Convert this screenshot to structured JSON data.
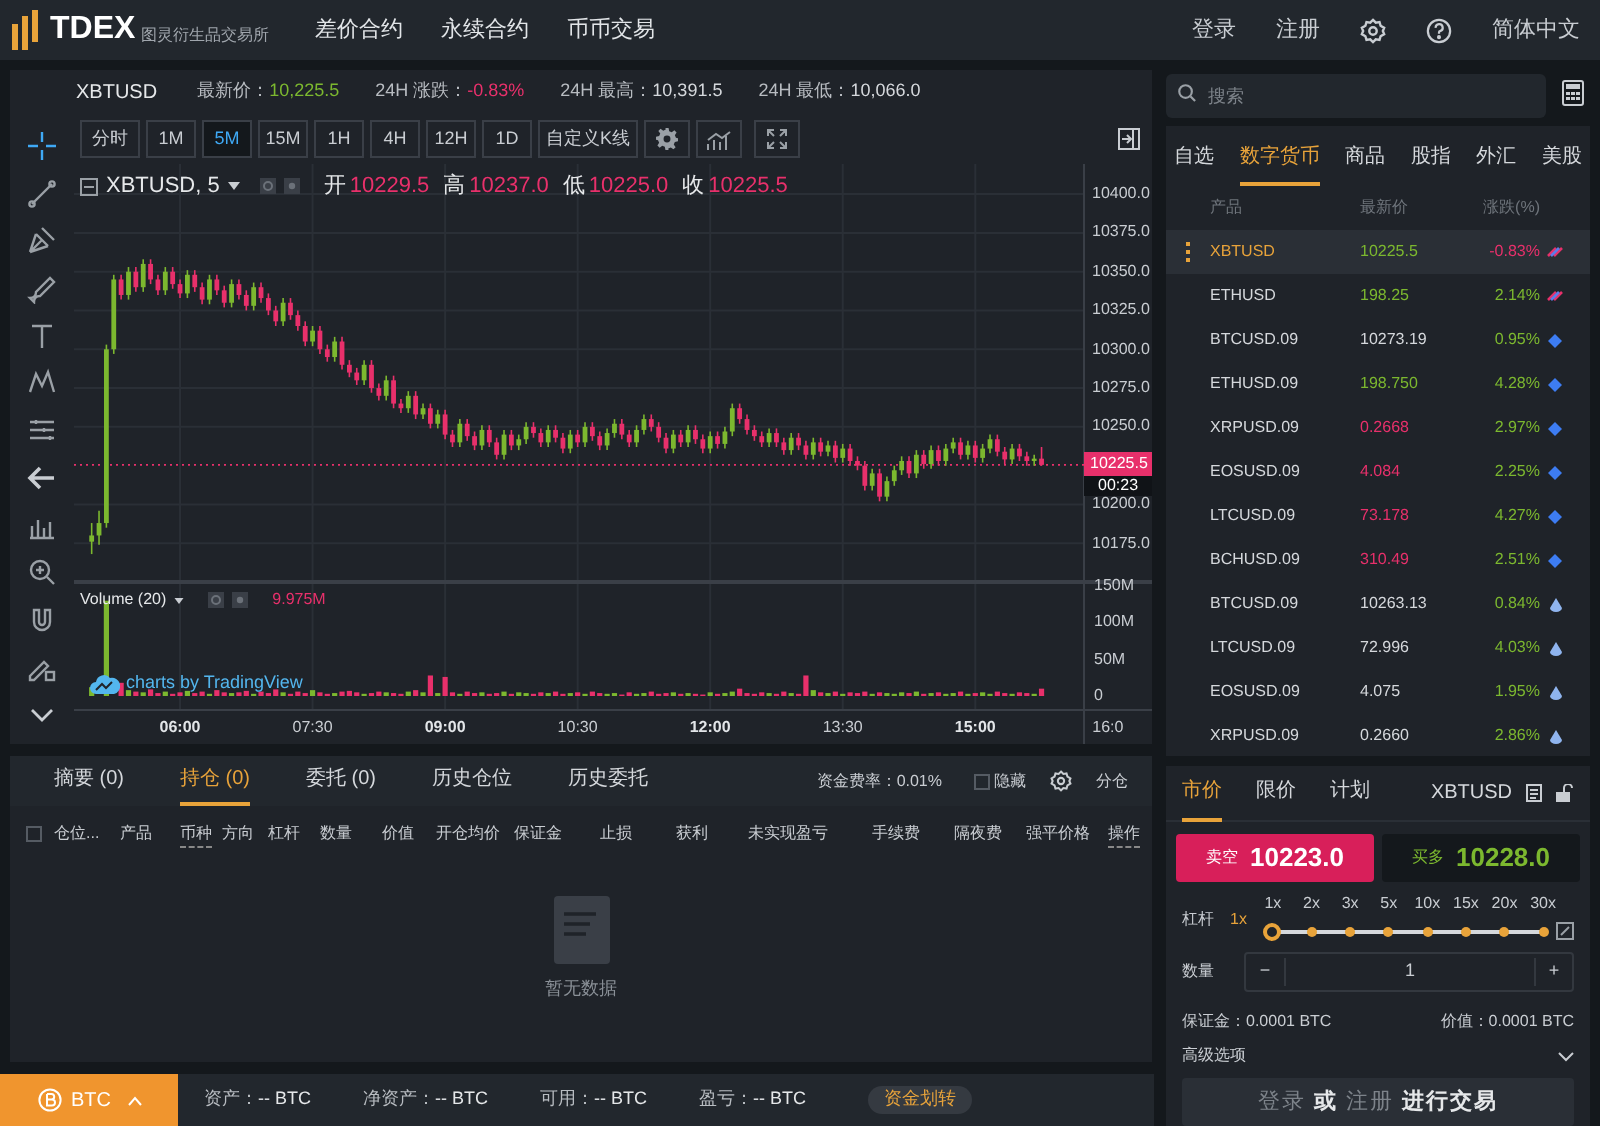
{
  "topbar": {
    "logo": "TDEX",
    "logo_subtitle": "图灵衍生品交易所",
    "nav": [
      "差价合约",
      "永续合约",
      "币币交易"
    ],
    "login": "登录",
    "register": "注册",
    "language": "简体中文"
  },
  "ticker": {
    "symbol": "XBTUSD",
    "stats": [
      {
        "label": "最新价：",
        "value": "10,225.5",
        "color": "#7cb82f"
      },
      {
        "label": "24H 涨跌：",
        "value": "-0.83%",
        "color": "#e8306b"
      },
      {
        "label": "24H 最高：",
        "value": "10,391.5",
        "color": "#d5d8dc"
      },
      {
        "label": "24H 最低：",
        "value": "10,066.0",
        "color": "#d5d8dc"
      }
    ]
  },
  "intervals": [
    {
      "label": "分时",
      "selected": false
    },
    {
      "label": "1M",
      "selected": false
    },
    {
      "label": "5M",
      "selected": true
    },
    {
      "label": "15M",
      "selected": false
    },
    {
      "label": "1H",
      "selected": false
    },
    {
      "label": "4H",
      "selected": false
    },
    {
      "label": "12H",
      "selected": false
    },
    {
      "label": "1D",
      "selected": false
    }
  ],
  "custom_k": "自定义K线",
  "chart": {
    "legend_symbol": "XBTUSD, 5",
    "ohlc_legend": [
      {
        "label": "开",
        "value": "10229.5"
      },
      {
        "label": "高",
        "value": "10237.0"
      },
      {
        "label": "低",
        "value": "10225.0"
      },
      {
        "label": "收",
        "value": "10225.5"
      }
    ],
    "last_price": "10225.5",
    "countdown": "00:23",
    "credit": "charts by TradingView",
    "chart_data": {
      "type": "candlestick",
      "xlim": [
        288,
        1020
      ],
      "ylim": [
        10150,
        10480
      ],
      "yticks": [
        {
          "value": 10400,
          "label": "10400.0"
        },
        {
          "value": 10375,
          "label": "10375.0"
        },
        {
          "value": 10350,
          "label": "10350.0"
        },
        {
          "value": 10325,
          "label": "10325.0"
        },
        {
          "value": 10300,
          "label": "10300.0"
        },
        {
          "value": 10275,
          "label": "10275.0"
        },
        {
          "value": 10250,
          "label": "10250.0"
        },
        {
          "value": 10200,
          "label": "10200.0"
        },
        {
          "value": 10175,
          "label": "10175.0"
        }
      ],
      "x": [
        300,
        305,
        310,
        315,
        320,
        325,
        330,
        335,
        340,
        345,
        350,
        355,
        360,
        365,
        370,
        375,
        380,
        385,
        390,
        395,
        400,
        405,
        410,
        415,
        420,
        425,
        430,
        435,
        440,
        445,
        450,
        455,
        460,
        465,
        470,
        475,
        480,
        485,
        490,
        495,
        500,
        505,
        510,
        515,
        520,
        525,
        530,
        535,
        540,
        545,
        550,
        555,
        560,
        565,
        570,
        575,
        580,
        585,
        590,
        595,
        600,
        605,
        610,
        615,
        620,
        625,
        630,
        635,
        640,
        645,
        650,
        655,
        660,
        665,
        670,
        675,
        680,
        685,
        690,
        695,
        700,
        705,
        710,
        715,
        720,
        725,
        730,
        735,
        740,
        745,
        750,
        755,
        760,
        765,
        770,
        775,
        780,
        785,
        790,
        795,
        800,
        805,
        810,
        815,
        820,
        825,
        830,
        835,
        840,
        845,
        850,
        855,
        860,
        865,
        870,
        875,
        880,
        885,
        890,
        895,
        900,
        905,
        910,
        915,
        920,
        925,
        930,
        935,
        940,
        945
      ],
      "ohlc": [
        [
          10176,
          10188,
          10168,
          10180
        ],
        [
          10180,
          10196,
          10174,
          10188
        ],
        [
          10188,
          10303,
          10185,
          10300
        ],
        [
          10300,
          10348,
          10297,
          10345
        ],
        [
          10345,
          10348,
          10332,
          10335
        ],
        [
          10335,
          10353,
          10332,
          10350
        ],
        [
          10350,
          10353,
          10337,
          10340
        ],
        [
          10340,
          10358,
          10337,
          10355
        ],
        [
          10355,
          10358,
          10342,
          10345
        ],
        [
          10345,
          10348,
          10335,
          10338
        ],
        [
          10338,
          10353,
          10335,
          10350
        ],
        [
          10350,
          10353,
          10339,
          10342
        ],
        [
          10342,
          10345,
          10333,
          10336
        ],
        [
          10336,
          10351,
          10333,
          10348
        ],
        [
          10348,
          10351,
          10337,
          10340
        ],
        [
          10340,
          10343,
          10329,
          10332
        ],
        [
          10332,
          10348,
          10329,
          10345
        ],
        [
          10345,
          10348,
          10335,
          10338
        ],
        [
          10338,
          10341,
          10327,
          10330
        ],
        [
          10330,
          10345,
          10327,
          10342
        ],
        [
          10342,
          10345,
          10332,
          10335
        ],
        [
          10335,
          10338,
          10325,
          10328
        ],
        [
          10328,
          10343,
          10325,
          10340
        ],
        [
          10340,
          10343,
          10330,
          10333
        ],
        [
          10333,
          10336,
          10322,
          10325
        ],
        [
          10325,
          10328,
          10315,
          10318
        ],
        [
          10318,
          10333,
          10315,
          10330
        ],
        [
          10330,
          10333,
          10319,
          10322
        ],
        [
          10322,
          10325,
          10312,
          10315
        ],
        [
          10315,
          10318,
          10302,
          10305
        ],
        [
          10305,
          10315,
          10302,
          10312
        ],
        [
          10312,
          10315,
          10297,
          10300
        ],
        [
          10300,
          10303,
          10292,
          10295
        ],
        [
          10295,
          10308,
          10292,
          10305
        ],
        [
          10305,
          10308,
          10287,
          10290
        ],
        [
          10290,
          10293,
          10282,
          10285
        ],
        [
          10285,
          10288,
          10277,
          10280
        ],
        [
          10280,
          10293,
          10277,
          10290
        ],
        [
          10290,
          10293,
          10272,
          10275
        ],
        [
          10275,
          10278,
          10267,
          10270
        ],
        [
          10270,
          10283,
          10267,
          10280
        ],
        [
          10280,
          10283,
          10262,
          10265
        ],
        [
          10265,
          10268,
          10259,
          10262
        ],
        [
          10262,
          10273,
          10259,
          10270
        ],
        [
          10270,
          10273,
          10255,
          10258
        ],
        [
          10258,
          10265,
          10255,
          10262
        ],
        [
          10262,
          10265,
          10249,
          10252
        ],
        [
          10252,
          10261,
          10249,
          10258
        ],
        [
          10258,
          10261,
          10242,
          10245
        ],
        [
          10245,
          10248,
          10237,
          10240
        ],
        [
          10240,
          10255,
          10237,
          10252
        ],
        [
          10252,
          10255,
          10241,
          10244
        ],
        [
          10244,
          10247,
          10235,
          10238
        ],
        [
          10238,
          10251,
          10235,
          10248
        ],
        [
          10248,
          10251,
          10237,
          10240
        ],
        [
          10240,
          10243,
          10229,
          10232
        ],
        [
          10232,
          10248,
          10229,
          10245
        ],
        [
          10245,
          10248,
          10235,
          10238
        ],
        [
          10238,
          10245,
          10235,
          10242
        ],
        [
          10242,
          10253,
          10239,
          10250
        ],
        [
          10250,
          10253,
          10243,
          10246
        ],
        [
          10246,
          10249,
          10237,
          10240
        ],
        [
          10240,
          10251,
          10237,
          10248
        ],
        [
          10248,
          10251,
          10240,
          10243
        ],
        [
          10243,
          10246,
          10233,
          10236
        ],
        [
          10236,
          10248,
          10233,
          10245
        ],
        [
          10245,
          10248,
          10237,
          10240
        ],
        [
          10240,
          10253,
          10237,
          10250
        ],
        [
          10250,
          10253,
          10241,
          10244
        ],
        [
          10244,
          10247,
          10235,
          10238
        ],
        [
          10238,
          10249,
          10235,
          10246
        ],
        [
          10246,
          10255,
          10243,
          10252
        ],
        [
          10252,
          10255,
          10242,
          10245
        ],
        [
          10245,
          10248,
          10237,
          10240
        ],
        [
          10240,
          10251,
          10237,
          10248
        ],
        [
          10248,
          10258,
          10245,
          10255
        ],
        [
          10255,
          10258,
          10247,
          10250
        ],
        [
          10250,
          10253,
          10240,
          10243
        ],
        [
          10243,
          10246,
          10233,
          10236
        ],
        [
          10236,
          10248,
          10233,
          10245
        ],
        [
          10245,
          10248,
          10237,
          10240
        ],
        [
          10240,
          10251,
          10237,
          10248
        ],
        [
          10248,
          10251,
          10239,
          10242
        ],
        [
          10242,
          10245,
          10233,
          10236
        ],
        [
          10236,
          10247,
          10233,
          10244
        ],
        [
          10244,
          10247,
          10236,
          10239
        ],
        [
          10239,
          10250,
          10236,
          10247
        ],
        [
          10247,
          10265,
          10244,
          10262
        ],
        [
          10262,
          10265,
          10252,
          10255
        ],
        [
          10255,
          10258,
          10245,
          10248
        ],
        [
          10248,
          10251,
          10241,
          10244
        ],
        [
          10244,
          10247,
          10237,
          10240
        ],
        [
          10240,
          10249,
          10237,
          10246
        ],
        [
          10246,
          10249,
          10237,
          10240
        ],
        [
          10240,
          10243,
          10232,
          10235
        ],
        [
          10235,
          10246,
          10232,
          10243
        ],
        [
          10243,
          10246,
          10235,
          10238
        ],
        [
          10238,
          10241,
          10229,
          10232
        ],
        [
          10232,
          10243,
          10229,
          10240
        ],
        [
          10240,
          10243,
          10231,
          10234
        ],
        [
          10234,
          10241,
          10231,
          10238
        ],
        [
          10238,
          10241,
          10227,
          10230
        ],
        [
          10230,
          10239,
          10227,
          10236
        ],
        [
          10236,
          10239,
          10225,
          10228
        ],
        [
          10228,
          10231,
          10222,
          10225
        ],
        [
          10225,
          10228,
          10209,
          10212
        ],
        [
          10212,
          10223,
          10209,
          10220
        ],
        [
          10220,
          10223,
          10202,
          10205
        ],
        [
          10205,
          10218,
          10202,
          10215
        ],
        [
          10215,
          10225,
          10212,
          10222
        ],
        [
          10222,
          10231,
          10219,
          10228
        ],
        [
          10228,
          10231,
          10217,
          10220
        ],
        [
          10220,
          10235,
          10217,
          10232
        ],
        [
          10232,
          10235,
          10223,
          10226
        ],
        [
          10226,
          10238,
          10223,
          10235
        ],
        [
          10235,
          10238,
          10225,
          10228
        ],
        [
          10228,
          10239,
          10225,
          10236
        ],
        [
          10236,
          10243,
          10233,
          10240
        ],
        [
          10240,
          10243,
          10229,
          10232
        ],
        [
          10232,
          10241,
          10229,
          10238
        ],
        [
          10238,
          10241,
          10227,
          10230
        ],
        [
          10230,
          10239,
          10227,
          10236
        ],
        [
          10236,
          10245,
          10233,
          10242
        ],
        [
          10242,
          10245,
          10231,
          10234
        ],
        [
          10234,
          10237,
          10226,
          10229
        ],
        [
          10229,
          10239,
          10226,
          10236
        ],
        [
          10236,
          10239,
          10228,
          10231
        ],
        [
          10231,
          10234,
          10225,
          10228
        ],
        [
          10228,
          10232,
          10225,
          10229.5
        ],
        [
          10229.5,
          10237,
          10225,
          10225.5
        ]
      ]
    }
  },
  "volume": {
    "legend": "Volume (20)",
    "value": "9.975M",
    "time_tick_bold": [
      true,
      false,
      true,
      false,
      true,
      false,
      true,
      false
    ],
    "chart_data": {
      "type": "bar",
      "xlim": [
        288,
        1020
      ],
      "ylim": [
        0,
        155.5
      ],
      "xticks": [
        {
          "value": 360,
          "label": "06:00"
        },
        {
          "value": 450,
          "label": "07:30"
        },
        {
          "value": 540,
          "label": "09:00"
        },
        {
          "value": 630,
          "label": "10:30"
        },
        {
          "value": 720,
          "label": "12:00"
        },
        {
          "value": 810,
          "label": "13:30"
        },
        {
          "value": 900,
          "label": "15:00"
        },
        {
          "value": 990,
          "label": "16:0"
        }
      ],
      "yticks": [
        {
          "value": 150,
          "label": "150M"
        },
        {
          "value": 100,
          "label": "100M"
        },
        {
          "value": 50,
          "label": "50M"
        },
        {
          "value": 0,
          "label": "0"
        }
      ],
      "x": [
        300,
        305,
        310,
        315,
        320,
        325,
        330,
        335,
        340,
        345,
        350,
        355,
        360,
        365,
        370,
        375,
        380,
        385,
        390,
        395,
        400,
        405,
        410,
        415,
        420,
        425,
        430,
        435,
        440,
        445,
        450,
        455,
        460,
        465,
        470,
        475,
        480,
        485,
        490,
        495,
        500,
        505,
        510,
        515,
        520,
        525,
        530,
        535,
        540,
        545,
        550,
        555,
        560,
        565,
        570,
        575,
        580,
        585,
        590,
        595,
        600,
        605,
        610,
        615,
        620,
        625,
        630,
        635,
        640,
        645,
        650,
        655,
        660,
        665,
        670,
        675,
        680,
        685,
        690,
        695,
        700,
        705,
        710,
        715,
        720,
        725,
        730,
        735,
        740,
        745,
        750,
        755,
        760,
        765,
        770,
        775,
        780,
        785,
        790,
        795,
        800,
        805,
        810,
        815,
        820,
        825,
        830,
        835,
        840,
        845,
        850,
        855,
        860,
        865,
        870,
        875,
        880,
        885,
        890,
        895,
        900,
        905,
        910,
        915,
        920,
        925,
        930,
        935,
        940,
        945
      ],
      "values": [
        12,
        null,
        130,
        null,
        18,
        8,
        6,
        5,
        9,
        4,
        6,
        3,
        5,
        7,
        4,
        6,
        3,
        8,
        5,
        4,
        5,
        7,
        3,
        6,
        4,
        9,
        5,
        3,
        6,
        4,
        8,
        5,
        3,
        4,
        6,
        7,
        5,
        3,
        4,
        6,
        5,
        4,
        3,
        6,
        8,
        5,
        28,
        4,
        26,
        5,
        3,
        6,
        4,
        5,
        3,
        4,
        6,
        3,
        5,
        4,
        3,
        5,
        4,
        6,
        3,
        4,
        5,
        3,
        6,
        4,
        3,
        4,
        2,
        5,
        3,
        4,
        6,
        3,
        4,
        5,
        3,
        4,
        3,
        2,
        5,
        3,
        4,
        6,
        10,
        4,
        3,
        5,
        4,
        3,
        6,
        4,
        3,
        28,
        8,
        5,
        4,
        6,
        3,
        5,
        4,
        6,
        3,
        5,
        4,
        3,
        5,
        4,
        6,
        3,
        4,
        5,
        3,
        4,
        6,
        3,
        4,
        5,
        3,
        6,
        4,
        3,
        5,
        4,
        3,
        10
      ]
    }
  },
  "positions": {
    "tabs": [
      {
        "label": "摘要 (0)",
        "selected": false
      },
      {
        "label": "持仓 (0)",
        "selected": true
      },
      {
        "label": "委托 (0)",
        "selected": false
      },
      {
        "label": "历史仓位",
        "selected": false
      },
      {
        "label": "历史委托",
        "selected": false
      }
    ],
    "funding_rate": "资金费率：0.01%",
    "hide": {
      "label": "隐藏",
      "checked": false
    },
    "split": "分仓",
    "select_all": {
      "checked": false
    },
    "columns": [
      {
        "label": "仓位...",
        "dotted": false
      },
      {
        "label": "产品",
        "dotted": false
      },
      {
        "label": "币种",
        "dotted": true
      },
      {
        "label": "方向",
        "dotted": false
      },
      {
        "label": "杠杆",
        "dotted": false
      },
      {
        "label": "数量",
        "dotted": false
      },
      {
        "label": "价值",
        "dotted": false
      },
      {
        "label": "开仓均价",
        "dotted": false
      },
      {
        "label": "保证金",
        "dotted": false
      },
      {
        "label": "止损",
        "dotted": false
      },
      {
        "label": "获利",
        "dotted": false
      },
      {
        "label": "未实现盈亏",
        "dotted": false
      },
      {
        "label": "手续费",
        "dotted": false
      },
      {
        "label": "隔夜费",
        "dotted": false
      },
      {
        "label": "强平价格",
        "dotted": false
      },
      {
        "label": "操作",
        "dotted": true
      }
    ],
    "empty": "暂无数据"
  },
  "footer": {
    "currency": "BTC",
    "stats": [
      {
        "label": "资产：",
        "value": "-- BTC"
      },
      {
        "label": "净资产：",
        "value": "-- BTC"
      },
      {
        "label": "可用：",
        "value": "-- BTC"
      },
      {
        "label": "盈亏：",
        "value": "-- BTC"
      }
    ],
    "transfer": "资金划转"
  },
  "search": {
    "placeholder": "搜索"
  },
  "market": {
    "tabs": [
      {
        "label": "自选",
        "selected": false
      },
      {
        "label": "数字货币",
        "selected": true
      },
      {
        "label": "商品",
        "selected": false
      },
      {
        "label": "股指",
        "selected": false
      },
      {
        "label": "外汇",
        "selected": false
      },
      {
        "label": "美股",
        "selected": false
      }
    ],
    "columns": [
      "产品",
      "最新价",
      "涨跌(%)"
    ],
    "rows": [
      {
        "symbol": "XBTUSD",
        "price": {
          "text": "10225.5",
          "color": "#7cb82f"
        },
        "change": {
          "text": "-0.83%",
          "color": "#e8306b"
        },
        "kind": "perpetual",
        "selected": true
      },
      {
        "symbol": "ETHUSD",
        "price": {
          "text": "198.25",
          "color": "#7cb82f"
        },
        "change": {
          "text": "2.14%",
          "color": "#7cb82f"
        },
        "kind": "perpetual",
        "selected": false
      },
      {
        "symbol": "BTCUSD.09",
        "price": {
          "text": "10273.19",
          "color": "#d5d8dc"
        },
        "change": {
          "text": "0.95%",
          "color": "#7cb82f"
        },
        "kind": "futures",
        "selected": false
      },
      {
        "symbol": "ETHUSD.09",
        "price": {
          "text": "198.750",
          "color": "#7cb82f"
        },
        "change": {
          "text": "4.28%",
          "color": "#7cb82f"
        },
        "kind": "futures",
        "selected": false
      },
      {
        "symbol": "XRPUSD.09",
        "price": {
          "text": "0.2668",
          "color": "#e8306b"
        },
        "change": {
          "text": "2.97%",
          "color": "#7cb82f"
        },
        "kind": "futures",
        "selected": false
      },
      {
        "symbol": "EOSUSD.09",
        "price": {
          "text": "4.084",
          "color": "#e8306b"
        },
        "change": {
          "text": "2.25%",
          "color": "#7cb82f"
        },
        "kind": "futures",
        "selected": false
      },
      {
        "symbol": "LTCUSD.09",
        "price": {
          "text": "73.178",
          "color": "#e8306b"
        },
        "change": {
          "text": "4.27%",
          "color": "#7cb82f"
        },
        "kind": "futures",
        "selected": false
      },
      {
        "symbol": "BCHUSD.09",
        "price": {
          "text": "310.49",
          "color": "#e8306b"
        },
        "change": {
          "text": "2.51%",
          "color": "#7cb82f"
        },
        "kind": "futures",
        "selected": false
      },
      {
        "symbol": "BTCUSD.09",
        "price": {
          "text": "10263.13",
          "color": "#d5d8dc"
        },
        "change": {
          "text": "0.84%",
          "color": "#7cb82f"
        },
        "kind": "spot",
        "selected": false
      },
      {
        "symbol": "LTCUSD.09",
        "price": {
          "text": "72.996",
          "color": "#d5d8dc"
        },
        "change": {
          "text": "4.03%",
          "color": "#7cb82f"
        },
        "kind": "spot",
        "selected": false
      },
      {
        "symbol": "EOSUSD.09",
        "price": {
          "text": "4.075",
          "color": "#d5d8dc"
        },
        "change": {
          "text": "1.95%",
          "color": "#7cb82f"
        },
        "kind": "spot",
        "selected": false
      },
      {
        "symbol": "XRPUSD.09",
        "price": {
          "text": "0.2660",
          "color": "#d5d8dc"
        },
        "change": {
          "text": "2.86%",
          "color": "#7cb82f"
        },
        "kind": "spot",
        "selected": false
      }
    ]
  },
  "order": {
    "tabs": [
      {
        "label": "市价",
        "selected": true
      },
      {
        "label": "限价",
        "selected": false
      },
      {
        "label": "计划",
        "selected": false
      }
    ],
    "symbol": "XBTUSD",
    "sell": {
      "label": "卖空",
      "price": "10223.0"
    },
    "buy": {
      "label": "买多",
      "price": "10228.0"
    },
    "leverage": {
      "label": "杠杆",
      "value": "1x",
      "options": [
        {
          "label": "1x",
          "selected": true
        },
        {
          "label": "2x",
          "selected": false
        },
        {
          "label": "3x",
          "selected": false
        },
        {
          "label": "5x",
          "selected": false
        },
        {
          "label": "10x",
          "selected": false
        },
        {
          "label": "15x",
          "selected": false
        },
        {
          "label": "20x",
          "selected": false
        },
        {
          "label": "30x",
          "selected": false
        }
      ]
    },
    "quantity": {
      "label": "数量",
      "minus": "−",
      "value": "1",
      "plus": "+"
    },
    "margin": "保证金：0.0001 BTC",
    "value": "价值：0.0001 BTC",
    "advanced": {
      "label": "高级选项",
      "expanded": false
    },
    "submit": "登录 **或** 注册 **进行交易**"
  }
}
